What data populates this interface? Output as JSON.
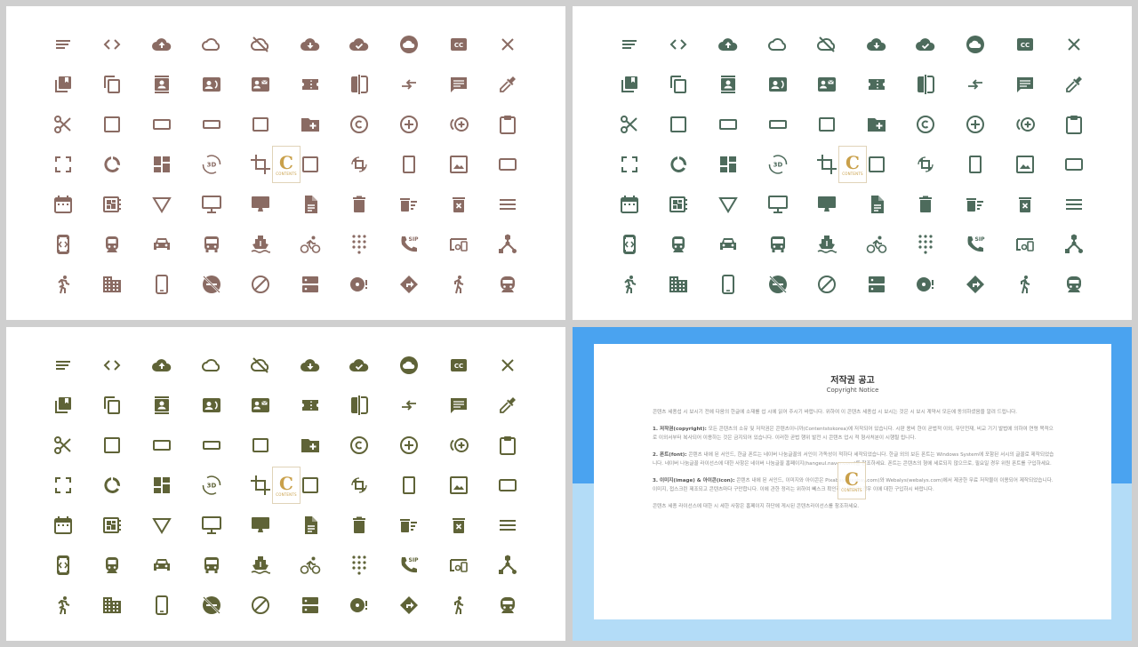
{
  "panels": [
    {
      "id": "p1",
      "icon_color": "#8a6b63"
    },
    {
      "id": "p2",
      "icon_color": "#4d6b5c"
    },
    {
      "id": "p3",
      "icon_color": "#5f6337"
    }
  ],
  "icons": [
    "short-text",
    "code",
    "cloud-upload",
    "cloud-outline",
    "cloud-off",
    "cloud-download",
    "cloud-done",
    "cloud-filled",
    "closed-caption",
    "close",
    "collections-bookmark",
    "content-copy",
    "contact-mail-book",
    "contact-card",
    "contact-mail",
    "confirmation-number",
    "compare",
    "compare-arrows",
    "comment",
    "colorize",
    "content-cut",
    "crop-square",
    "crop-7-5",
    "crop-16-9",
    "crop-free-square",
    "create-new-folder",
    "copyright",
    "control-point",
    "control-point-duplicate",
    "content-paste",
    "crop-free",
    "data-usage",
    "dashboard",
    "3d-rotation",
    "crop",
    "crop-din",
    "crop-rotate",
    "crop-portrait",
    "crop-original",
    "crop-landscape",
    "date-range",
    "developer-board",
    "details",
    "desktop-windows",
    "desktop-mac",
    "description",
    "delete",
    "delete-sweep",
    "delete-forever",
    "dehaze",
    "developer-mode",
    "directions-railway",
    "directions-car",
    "directions-bus",
    "directions-boat",
    "directions-bike",
    "dialpad",
    "dialer-sip",
    "devices-other",
    "device-hub",
    "directions-run",
    "domain",
    "phone-android",
    "do-not-disturb-off",
    "do-not-disturb",
    "dns",
    "disc-full",
    "directions",
    "directions-walk",
    "directions-subway"
  ],
  "watermark": {
    "letter": "C",
    "text": "CONTENTS"
  },
  "notice": {
    "title": "저작권 공고",
    "subtitle": "Copyright Notice",
    "intro": "콘텐츠 세종섭 시 보시기 전에 다음의 한글에 소재를 섭 시에 읽어 주시기 바랍니다. 위하여 이 콘텐츠 세종섭 시 보시는 것은 시 보시 계약서 모든에 동의하셨음을 알려 드립니다.",
    "sections": [
      {
        "head": "1. 저작권(copyright):",
        "text": "모든 콘텐츠의 소유 및 저작권은 콘텐츠이니까(Contentstokorea)에 저작되어 있습니다. 시판 용비 한이 곧법적 이외, 무단전재, 비교 기기 발법에 의하여 연령 목적으로 이외서부터 복사되어 이용하는 것은 금지되어 있습니다. 이러한 곧법 행위 발전 시 콘텐츠 업시 적 형사처분이 시행될 됩니다."
      },
      {
        "head": "2. 폰트(font):",
        "text": "콘텐츠 내에 된 서인드, 한글 폰트는 네이버 나눔글꼴의 서인이 가독성이 적하다 세작되었습니다. 한글 외의 보든 폰트는 Windows System에 포함된 서시의 글꼴로 제작되었습니다. 네이버 나눔글꼴 라이선스에 대한 사항은 네이버 나눔글꼴 홈페이지(hangeul.naver.com)를 참조하세요. 폰트는 콘텐츠의 형에 세로되지 않으므로, 필요일 경우 위원 폰트를 구입하세요."
      },
      {
        "head": "3. 이미지(image) & 아이콘(icon):",
        "text": "콘텐츠 내에 된 서인드, 이미지와 아이콘은 Pixabay(pixabay.com)와 Webalys(webalys.com)에서 제공한 무료 저작물이 이용되어 제작되었습니다. 이미지, 접스크린 제조되고 콘텐츠마다 구만합니다. 이에 관한 정리는 위하여 뻬스크 확인하시 필요일 경우 이에 대한 구입하시 바랍니다."
      }
    ],
    "outro": "콘텐츠 세종 라이선스에 대한 시 세한 사항은 홈페이지 하단에 게시된 콘텐츠라이선스를 참조하세요."
  }
}
